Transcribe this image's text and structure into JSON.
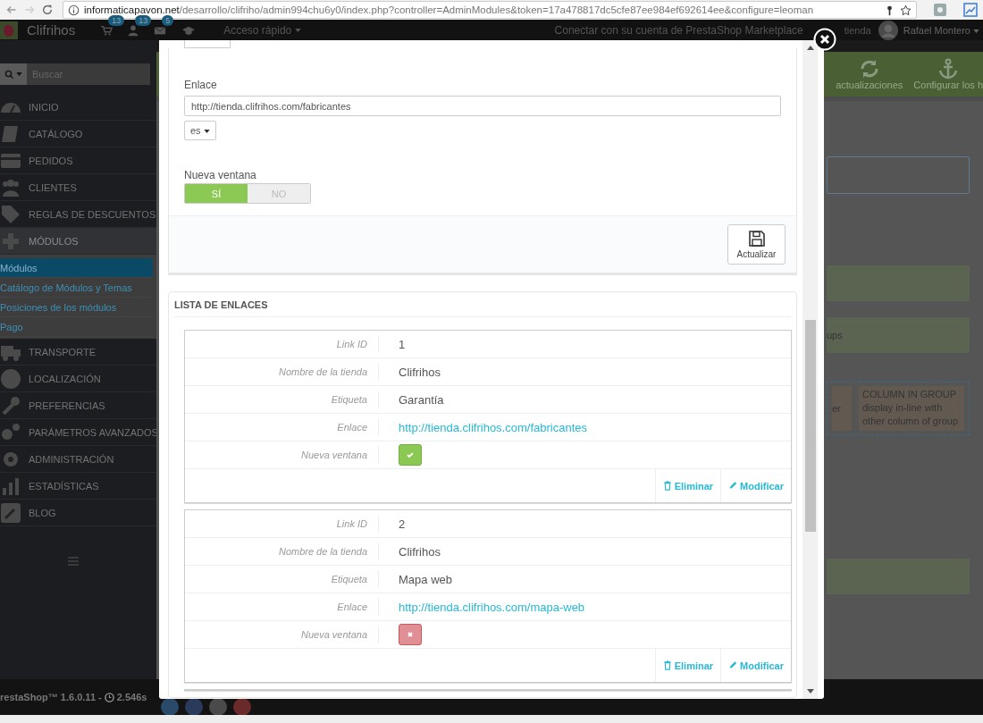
{
  "browser": {
    "url_host": "informaticapavon.net",
    "url_path": "/desarrollo/clifriho/admin994chu6y0/index.php?controller=AdminModules&token=17a478817dc5cfe87ee984ef692614ee&configure=leoman"
  },
  "header": {
    "shop_name": "Clifrihos",
    "badges": [
      {
        "count": "13"
      },
      {
        "count": "13"
      },
      {
        "count": "5"
      }
    ],
    "quick_access": "Acceso rápido",
    "marketplace_link": "Conectar con su cuenta de PrestaShop Marketplace",
    "shop_link": "tienda",
    "user_name": "Rafael Montero"
  },
  "sidebar": {
    "search_placeholder": "Buscar",
    "items": [
      {
        "label": "INICIO",
        "selected": false
      },
      {
        "label": "CATÁLOGO",
        "selected": false
      },
      {
        "label": "PEDIDOS",
        "selected": false
      },
      {
        "label": "CLIENTES",
        "selected": false
      },
      {
        "label": "REGLAS DE DESCUENTOS",
        "selected": false
      },
      {
        "label": "MÓDULOS",
        "selected": true,
        "children": [
          {
            "label": "Módulos",
            "selected": true
          },
          {
            "label": "Catálogo de Módulos y Temas",
            "selected": false
          },
          {
            "label": "Posiciones de los módulos",
            "selected": false
          },
          {
            "label": "Pago",
            "selected": false
          }
        ]
      },
      {
        "label": "TRANSPORTE",
        "selected": false
      },
      {
        "label": "LOCALIZACIÓN",
        "selected": false
      },
      {
        "label": "PREFERENCIAS",
        "selected": false
      },
      {
        "label": "PARÁMETROS AVANZADOS",
        "selected": false
      },
      {
        "label": "ADMINISTRACIÓN",
        "selected": false
      },
      {
        "label": "ESTADÍSTICAS",
        "selected": false
      },
      {
        "label": "BLOG",
        "selected": false
      }
    ]
  },
  "toolbar": {
    "buttons": [
      {
        "label": "actualizaciones",
        "kind": "refresh"
      },
      {
        "label": "Configurar los h",
        "kind": "anchor"
      }
    ]
  },
  "background": {
    "note": "ups",
    "column_cells": [
      "er",
      "COLUMN IN GROUP display in-line with other column of group"
    ]
  },
  "modal": {
    "form": {
      "link_label": "Enlace",
      "link_value": "http://tienda.clifrihos.com/fabricantes",
      "language": "es",
      "new_window_label": "Nueva ventana",
      "toggle": [
        {
          "label": "SÍ",
          "selected": true
        },
        {
          "label": "NO",
          "selected": false
        }
      ],
      "save_button": "Actualizar"
    },
    "list": {
      "title": "LISTA DE ENLACES",
      "records": [
        {
          "fields": [
            {
              "label": "Link ID",
              "kind": "text",
              "value": "1"
            },
            {
              "label": "Nombre de la tienda",
              "kind": "text",
              "value": "Clifrihos"
            },
            {
              "label": "Etiqueta",
              "kind": "text",
              "value": "Garantía"
            },
            {
              "label": "Enlace",
              "kind": "link",
              "value": "http://tienda.clifrihos.com/fabricantes"
            },
            {
              "label": "Nueva ventana",
              "kind": "bool",
              "on": true
            }
          ],
          "actions": [
            {
              "label": "Eliminar",
              "kind": "delete"
            },
            {
              "label": "Modificar",
              "kind": "edit"
            }
          ]
        },
        {
          "fields": [
            {
              "label": "Link ID",
              "kind": "text",
              "value": "2"
            },
            {
              "label": "Nombre de la tienda",
              "kind": "text",
              "value": "Clifrihos"
            },
            {
              "label": "Etiqueta",
              "kind": "text",
              "value": "Mapa web"
            },
            {
              "label": "Enlace",
              "kind": "link",
              "value": "http://tienda.clifrihos.com/mapa-web"
            },
            {
              "label": "Nueva ventana",
              "kind": "bool",
              "on": false
            }
          ],
          "actions": [
            {
              "label": "Eliminar",
              "kind": "delete"
            },
            {
              "label": "Modificar",
              "kind": "edit"
            }
          ]
        }
      ]
    }
  },
  "footer": {
    "version": "restaShop™ 1.6.0.11 -",
    "load_time": "2.546s"
  }
}
